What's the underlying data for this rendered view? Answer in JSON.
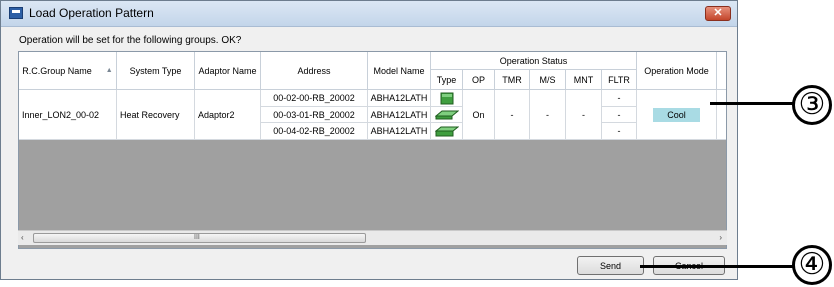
{
  "window": {
    "title": "Load Operation Pattern",
    "message": "Operation will be set for the following groups. OK?"
  },
  "table": {
    "headers": {
      "rc_group_name": "R.C.Group Name",
      "system_type": "System Type",
      "adaptor_name": "Adaptor Name",
      "address": "Address",
      "model_name": "Model Name",
      "operation_status": "Operation Status",
      "type": "Type",
      "op": "OP",
      "tmr": "TMR",
      "ms": "M/S",
      "mnt": "MNT",
      "fltr": "FLTR",
      "operation_mode": "Operation Mode"
    },
    "group": {
      "rc_group_name": "Inner_LON2_00-02",
      "system_type": "Heat Recovery",
      "adaptor_name": "Adaptor2",
      "op": "On",
      "tmr": "-",
      "ms": "-",
      "mnt": "-",
      "operation_mode": "Cool",
      "mode_color": "#a9dbe4"
    },
    "units": [
      {
        "address": "00-02-00-RB_20002",
        "model": "ABHA12LATH",
        "type_icon": "indoor-unit-wall-icon",
        "fltr": "-"
      },
      {
        "address": "00-03-01-RB_20002",
        "model": "ABHA12LATH",
        "type_icon": "indoor-unit-slim-icon",
        "fltr": "-"
      },
      {
        "address": "00-04-02-RB_20002",
        "model": "ABHA12LATH",
        "type_icon": "indoor-unit-ceiling-icon",
        "fltr": "-"
      }
    ]
  },
  "scrollbar": {
    "left_arrow": "‹",
    "right_arrow": "›",
    "grip": "III"
  },
  "buttons": {
    "send": "Send",
    "cancel": "Cancel"
  },
  "callouts": {
    "c3": "③",
    "c4": "④"
  }
}
